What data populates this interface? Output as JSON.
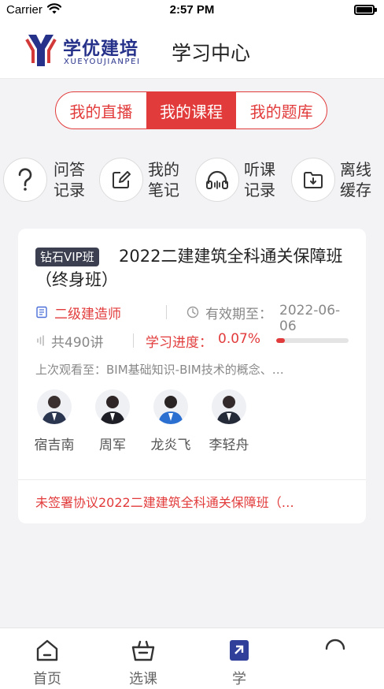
{
  "status_bar": {
    "carrier": "Carrier",
    "time": "2:57 PM"
  },
  "header": {
    "logo_cn": "学优建培",
    "logo_en": "XUEYOUJIANPEI",
    "title": "学习中心"
  },
  "segment": {
    "tabs": [
      {
        "label": "我的直播"
      },
      {
        "label": "我的课程"
      },
      {
        "label": "我的题库"
      }
    ],
    "active_index": 1
  },
  "quick_actions": [
    {
      "line1": "问答",
      "line2": "记录",
      "icon": "question-icon"
    },
    {
      "line1": "我的",
      "line2": "笔记",
      "icon": "edit-icon"
    },
    {
      "line1": "听课",
      "line2": "记录",
      "icon": "headphones-icon"
    },
    {
      "line1": "离线",
      "line2": "缓存",
      "icon": "download-folder-icon"
    }
  ],
  "course": {
    "badge": "钻石VIP班",
    "title": "2022二建建筑全科通关保障班（终身班）",
    "category": "二级建造师",
    "valid_label": "有效期至：",
    "valid_date": "2022-06-06",
    "lessons": "共490讲",
    "progress_label": "学习进度：",
    "progress_value": "0.07%",
    "progress_fraction": 0.12,
    "last_watched": "上次观看至：BIM基础知识-BIM技术的概念、…",
    "teachers": [
      {
        "name": "宿吉南"
      },
      {
        "name": "周军"
      },
      {
        "name": "龙炎飞"
      },
      {
        "name": "李轻舟"
      }
    ],
    "agreement": "未签署协议2022二建建筑全科通关保障班（…"
  },
  "tabbar": {
    "items": [
      {
        "label": "首页"
      },
      {
        "label": "选课"
      },
      {
        "label": "学"
      },
      {
        "label": ""
      }
    ]
  },
  "colors": {
    "accent": "#e23b3b",
    "brand": "#26318a"
  }
}
